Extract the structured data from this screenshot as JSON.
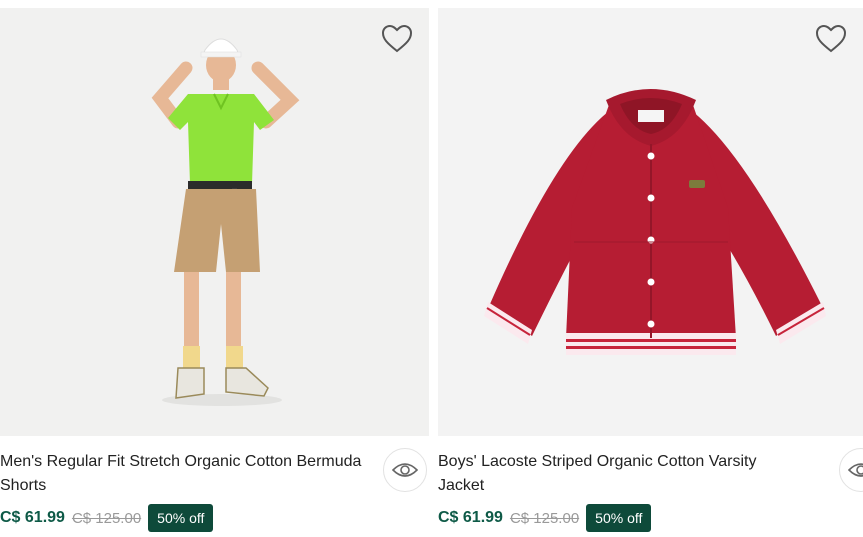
{
  "products": [
    {
      "title": "Men's Regular Fit Stretch Organic Cotton Bermuda Shorts",
      "price": "C$ 61.99",
      "original_price": "C$ 125.00",
      "discount": "50% off",
      "image": "man-green-polo-beige-shorts"
    },
    {
      "title": "Boys' Lacoste Striped Organic Cotton Varsity Jacket",
      "price": "C$ 61.99",
      "original_price": "C$ 125.00",
      "discount": "50% off",
      "image": "red-varsity-jacket"
    }
  ],
  "colors": {
    "price": "#0e5a47",
    "badge": "#0e4a3a"
  },
  "icons": {
    "wishlist": "heart-icon",
    "quick_view": "eye-icon"
  }
}
